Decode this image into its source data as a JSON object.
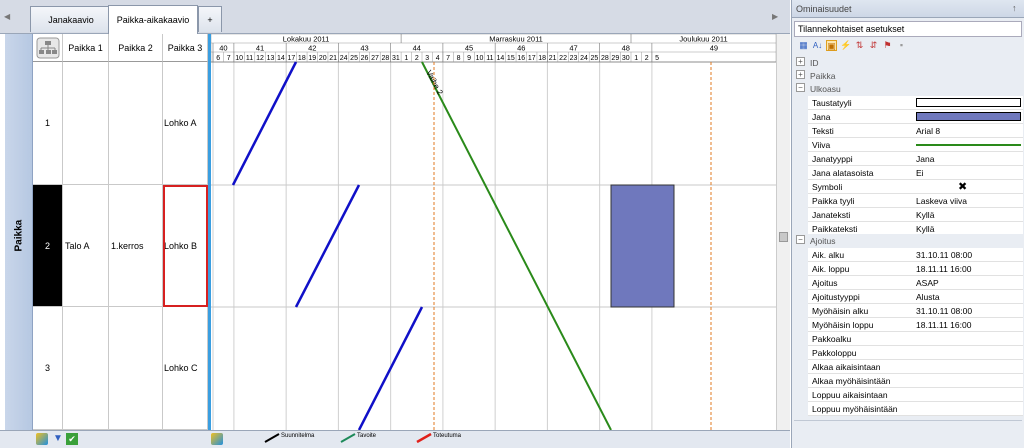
{
  "tabs": [
    {
      "label": "Janakaavio"
    },
    {
      "label": "Paikka-aikakaavio"
    },
    {
      "label": "+"
    }
  ],
  "left_header": {
    "label": "Paikka"
  },
  "table": {
    "columns": [
      "Paikka 1",
      "Paikka 2",
      "Paikka 3"
    ],
    "rows": [
      {
        "num": "1",
        "paikka1": "",
        "paikka2": "",
        "paikka3": "Lohko A"
      },
      {
        "num": "2",
        "paikka1": "Talo A",
        "paikka2": "1.kerros",
        "paikka3": "Lohko B"
      },
      {
        "num": "3",
        "paikka1": "",
        "paikka2": "",
        "paikka3": "Lohko C"
      }
    ]
  },
  "timeline": {
    "months": [
      {
        "label": "Lokakuu 2011"
      },
      {
        "label": "Marraskuu 2011"
      },
      {
        "label": "Joulukuu 2011"
      }
    ],
    "weeks": [
      "40",
      "41",
      "42",
      "43",
      "44",
      "45",
      "46",
      "47",
      "48",
      "49"
    ],
    "days": [
      "6",
      "7",
      "10",
      "11",
      "12",
      "13",
      "14",
      "17",
      "18",
      "19",
      "20",
      "21",
      "24",
      "25",
      "26",
      "27",
      "28",
      "31",
      "1",
      "2",
      "3",
      "4",
      "7",
      "8",
      "9",
      "10",
      "11",
      "14",
      "15",
      "16",
      "17",
      "18",
      "21",
      "22",
      "23",
      "24",
      "25",
      "28",
      "29",
      "30",
      "1",
      "2",
      "5"
    ]
  },
  "chart_labels": {
    "diagonal": "Vaihe 2"
  },
  "legend": [
    {
      "label": "Suunnitelma",
      "color": "#000000"
    },
    {
      "label": "Tavoite",
      "color": "#1e8a5a"
    },
    {
      "label": "Toteutuma",
      "color": "#e0201a"
    }
  ],
  "colors": {
    "blue_line": "#1010c8",
    "green_line": "#2a8a1a",
    "block_fill": "#6f78bd",
    "today_line": "#e07a20"
  },
  "panel": {
    "title": "Ominaisuudet",
    "pin": "↑",
    "dropdown": "Tilannekohtaiset asetukset",
    "sections": {
      "id": "ID",
      "paikka": "Paikka",
      "ulkoasu": "Ulkoasu",
      "ajoitus": "Ajoitus"
    },
    "ulkoasu": [
      {
        "k": "Taustatyyli",
        "v": ""
      },
      {
        "k": "Jana",
        "v": ""
      },
      {
        "k": "Teksti",
        "v": "Arial 8"
      },
      {
        "k": "Viiva",
        "v": ""
      },
      {
        "k": "Janatyyppi",
        "v": "Jana"
      },
      {
        "k": "Jana alatasoista",
        "v": "Ei"
      },
      {
        "k": "Symboli",
        "v": "✖"
      },
      {
        "k": "Paikka tyyli",
        "v": "Laskeva viiva"
      },
      {
        "k": "Janateksti",
        "v": "Kyllä"
      },
      {
        "k": "Paikkateksti",
        "v": "Kyllä"
      }
    ],
    "ajoitus": [
      {
        "k": "Aik. alku",
        "v": "31.10.11 08:00"
      },
      {
        "k": "Aik. loppu",
        "v": "18.11.11 16:00"
      },
      {
        "k": "Ajoitus",
        "v": "ASAP"
      },
      {
        "k": "Ajoitustyyppi",
        "v": "Alusta"
      },
      {
        "k": "Myöhäisin alku",
        "v": "31.10.11 08:00"
      },
      {
        "k": "Myöhäisin loppu",
        "v": "18.11.11 16:00"
      },
      {
        "k": "Pakkoalku",
        "v": ""
      },
      {
        "k": "Pakkoloppu",
        "v": ""
      },
      {
        "k": "Alkaa aikaisintaan",
        "v": ""
      },
      {
        "k": "Alkaa myöhäisintään",
        "v": ""
      },
      {
        "k": "Loppuu aikaisintaan",
        "v": ""
      },
      {
        "k": "Loppuu myöhäisintään",
        "v": ""
      }
    ]
  }
}
